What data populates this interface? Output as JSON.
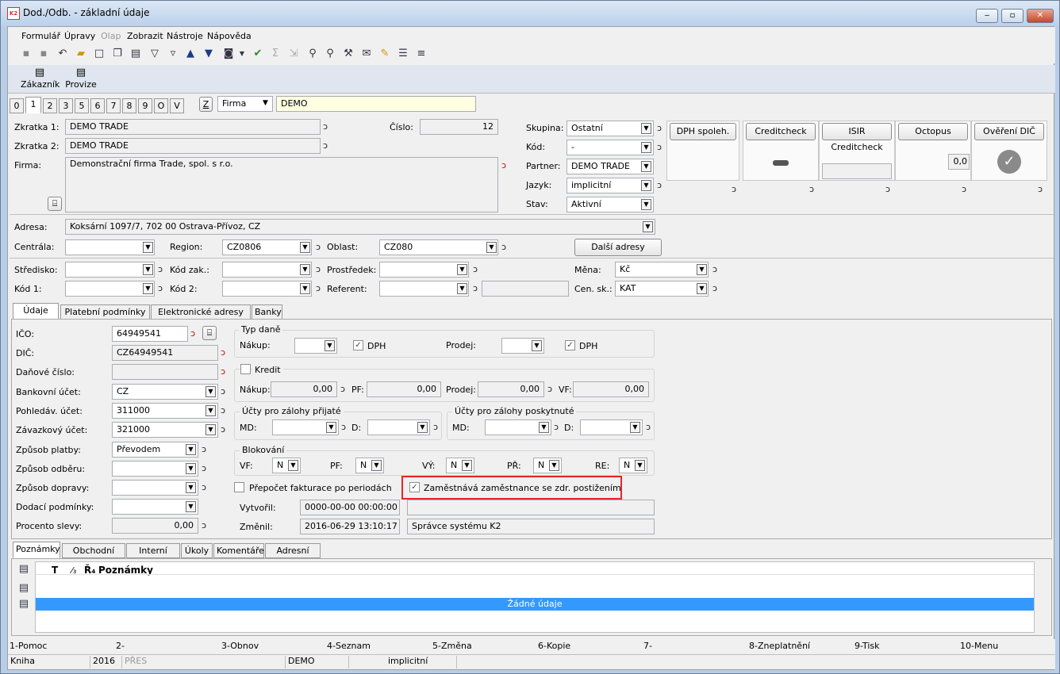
{
  "window": {
    "title": "Dod./Odb. - základní údaje",
    "min": "‒",
    "max": "▫",
    "close": "✕",
    "app_icon": "K2"
  },
  "menu": [
    "Formulář",
    "Úpravy",
    "Olap",
    "Zobrazit",
    "Nástroje",
    "Nápověda"
  ],
  "big_buttons": {
    "customer": "Zákazník",
    "commission": "Provize"
  },
  "page_tabs": [
    "0",
    "1",
    "2",
    "3",
    "5",
    "6",
    "7",
    "8",
    "9",
    "O",
    "V"
  ],
  "search": {
    "z_button": "Z",
    "type": "Firma",
    "value": "DEMO"
  },
  "header": {
    "zkratka1_label": "Zkratka 1:",
    "zkratka1": "DEMO TRADE",
    "zkratka2_label": "Zkratka 2:",
    "zkratka2": "DEMO TRADE",
    "firma_label": "Firma:",
    "firma": "Demonstrační firma Trade, spol. s r.o.",
    "cislo_label": "Číslo:",
    "cislo": "12",
    "skupina_label": "Skupina:",
    "skupina": "Ostatní",
    "kod_label": "Kód:",
    "kod": "-",
    "partner_label": "Partner:",
    "partner": "DEMO TRADE",
    "jazyk_label": "Jazyk:",
    "jazyk": "implicitní",
    "stav_label": "Stav:",
    "stav": "Aktivní"
  },
  "check_buttons": {
    "dph": "DPH spoleh.",
    "creditcheck": "Creditcheck",
    "isir": "ISIR Creditcheck",
    "octopus": "Octopus",
    "octopus_value": "0,0",
    "overeni": "Ověření DIČ"
  },
  "address": {
    "adresa_label": "Adresa:",
    "adresa": "Koksární 1097/7, 702 00  Ostrava-Přívoz, CZ",
    "centrala_label": "Centrála:",
    "centrala": "",
    "region_label": "Region:",
    "region": "CZ0806",
    "oblast_label": "Oblast:",
    "oblast": "CZ080",
    "dalsi_adresy": "Další adresy"
  },
  "misc": {
    "stredisko_label": "Středisko:",
    "kodzak_label": "Kód zak.:",
    "prostredek_label": "Prostředek:",
    "mena_label": "Měna:",
    "mena": "Kč",
    "kod1_label": "Kód 1:",
    "kod2_label": "Kód 2:",
    "referent_label": "Referent:",
    "censk_label": "Cen. sk.:",
    "censk": "KAT"
  },
  "detail_tabs": [
    "Údaje (P)",
    "Platební podmínky (J)",
    "Elektronické adresy (H)",
    "Banky"
  ],
  "detail": {
    "ico_label": "IČO:",
    "ico": "64949541",
    "dic_label": "DIČ:",
    "dic": "CZ64949541",
    "danove_label": "Daňové číslo:",
    "danove": "",
    "bank_label": "Bankovní účet:",
    "bank": "CZ",
    "pohl_label": "Pohledáv. účet:",
    "pohl": "311000",
    "zav_label": "Závazkový účet:",
    "zav": "321000",
    "platba_label": "Způsob platby:",
    "platba": "Převodem",
    "odber_label": "Způsob odběru:",
    "doprava_label": "Způsob dopravy:",
    "dodaci_label": "Dodací podmínky:",
    "sleva_label": "Procento slevy:",
    "sleva": "0,00"
  },
  "tax": {
    "title": "Typ daně",
    "nakup_label": "Nákup:",
    "dph1": "DPH",
    "prodej_label": "Prodej:",
    "dph2": "DPH",
    "dph1_check": "✓",
    "dph2_check": "✓"
  },
  "credit": {
    "title": "Kredit",
    "nakup_label": "Nákup:",
    "nakup": "0,00",
    "pf_label": "PF:",
    "pf": "0,00",
    "prodej_label": "Prodej:",
    "prodej": "0,00",
    "vf_label": "VF:",
    "vf": "0,00"
  },
  "advances": {
    "prijate_title": "Účty pro zálohy přijaté",
    "poskytnute_title": "Účty pro zálohy poskytnuté",
    "md_label": "MD:",
    "d_label": "D:"
  },
  "blocking": {
    "title": "Blokování",
    "items": [
      {
        "label": "VF:",
        "value": "N"
      },
      {
        "label": "PF:",
        "value": "N"
      },
      {
        "label": "VÝ:",
        "value": "N"
      },
      {
        "label": "PŘ:",
        "value": "N"
      },
      {
        "label": "RE:",
        "value": "N"
      }
    ]
  },
  "options": {
    "prepocet": "Přepočet fakturace po periodách",
    "zamestnava": "Zaměstnává zaměstnance se zdr. postižením",
    "zamestnava_check": "✓",
    "highlight_color": "#e8242a"
  },
  "audit": {
    "vytvoril_label": "Vytvořil:",
    "vytvoril_date": "0000-00-00 00:00:00",
    "vytvoril_user": "",
    "zmenil_label": "Změnil:",
    "zmenil_date": "2016-06-29 13:10:17",
    "zmenil_user": "Správce systému K2"
  },
  "note_tabs": [
    "Poznámky",
    "Obchodní text",
    "Interní text",
    "Úkoly",
    "Komentáře",
    "Adresní klíče"
  ],
  "notes": {
    "col_t": "T",
    "col_sort": "⁄₃",
    "col_r": "Ř₄",
    "col_notes": "Poznámky",
    "empty": "Žádné údaje",
    "empty_color": "#3399ff"
  },
  "fkeys": [
    "1-Pomoc",
    "2-",
    "3-Obnov",
    "4-Seznam",
    "5-Změna",
    "6-Kopie",
    "7-",
    "8-Zneplatnění",
    "9-Tisk",
    "10-Menu"
  ],
  "status": {
    "kniha": "Kniha",
    "year": "2016",
    "pres": "PŘES",
    "firm": "DEMO",
    "lang": "implicitní"
  }
}
